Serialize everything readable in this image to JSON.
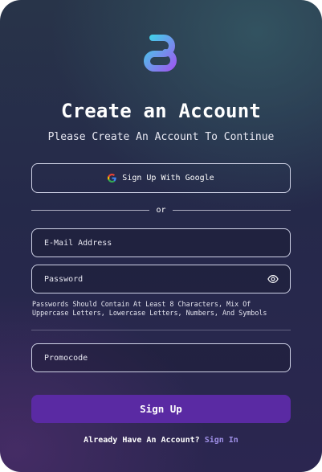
{
  "form": {
    "title": "Create an Account",
    "subtitle": "Please Create An Account To Continue",
    "google_button_label": "Sign Up With Google",
    "divider_text": "or",
    "email": {
      "placeholder": "E-Mail Address",
      "value": ""
    },
    "password": {
      "placeholder": "Password",
      "value": ""
    },
    "password_hint": "Passwords Should Contain At Least 8 Characters, Mix Of Uppercase Letters, Lowercase Letters, Numbers, And Symbols",
    "promocode": {
      "placeholder": "Promocode",
      "value": ""
    },
    "submit_label": "Sign Up"
  },
  "footer": {
    "prompt": "Already Have An Account?",
    "signin_link": "Sign In"
  },
  "icons": {
    "logo": "brand-logo-icon",
    "google": "google-icon",
    "password_toggle": "eye-icon"
  },
  "colors": {
    "primary_button": "#5a2aa3",
    "link": "#9e8fe6",
    "logo_gradient_start": "#3fd3e8",
    "logo_gradient_end": "#9b5cf0"
  }
}
